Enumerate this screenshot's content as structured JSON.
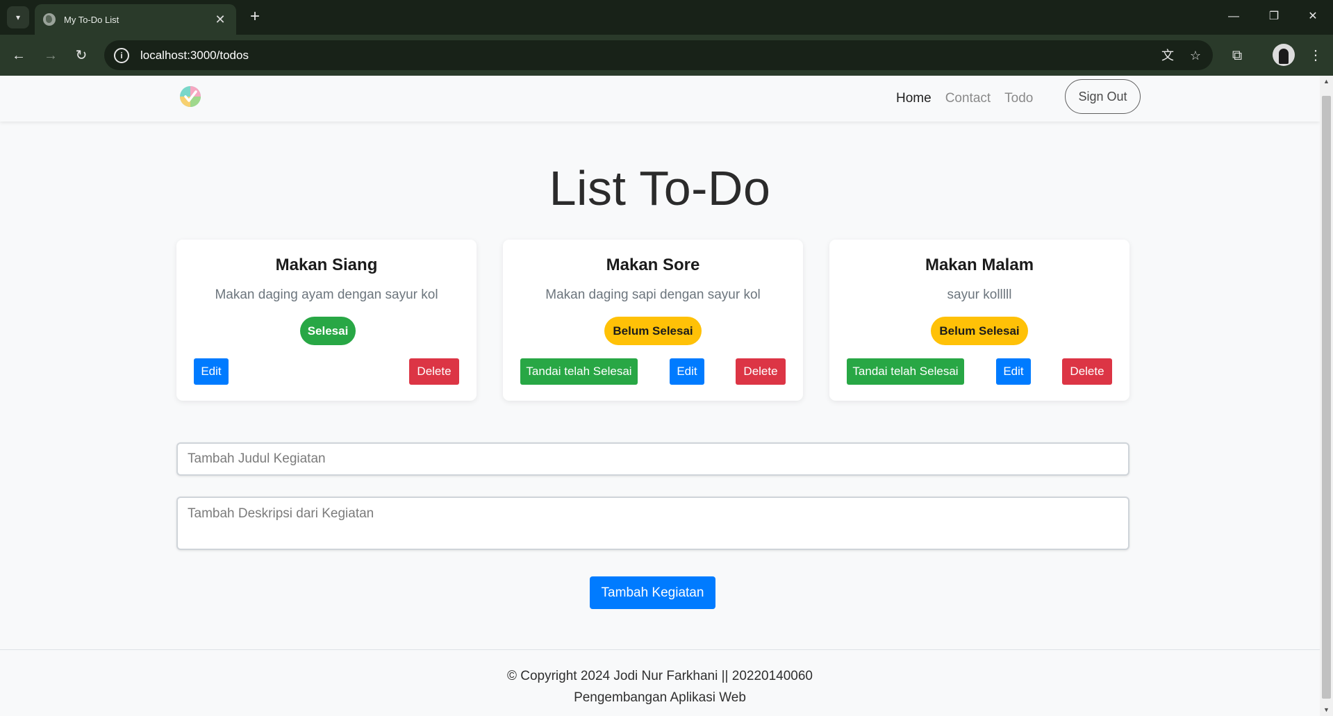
{
  "browser": {
    "tab_title": "My To-Do List",
    "url": "localhost:3000/todos"
  },
  "navbar": {
    "links": [
      "Home",
      "Contact",
      "Todo"
    ],
    "active_link": "Home",
    "signout_label": "Sign Out"
  },
  "page": {
    "title": "List To-Do"
  },
  "todos": [
    {
      "title": "Makan Siang",
      "description": "Makan daging ayam dengan sayur kol",
      "status": "Selesai",
      "edit_label": "Edit",
      "delete_label": "Delete"
    },
    {
      "title": "Makan Sore",
      "description": "Makan daging sapi dengan sayur kol",
      "status": "Belum Selesai",
      "mark_done_label": "Tandai telah Selesai",
      "edit_label": "Edit",
      "delete_label": "Delete"
    },
    {
      "title": "Makan Malam",
      "description": "sayur kolllll",
      "status": "Belum Selesai",
      "mark_done_label": "Tandai telah Selesai",
      "edit_label": "Edit",
      "delete_label": "Delete"
    }
  ],
  "form": {
    "title_placeholder": "Tambah Judul Kegiatan",
    "title_value": "",
    "description_placeholder": "Tambah Deskripsi dari Kegiatan",
    "description_value": "",
    "submit_label": "Tambah Kegiatan"
  },
  "footer": {
    "copyright": "© Copyright 2024 Jodi Nur Farkhani || 20220140060",
    "subtitle": "Pengembangan Aplikasi Web"
  },
  "colors": {
    "primary": "#007bff",
    "success": "#28a745",
    "warning": "#ffc107",
    "danger": "#dc3545",
    "chrome_dark": "#182218",
    "chrome_mid": "#2a3a2a"
  }
}
